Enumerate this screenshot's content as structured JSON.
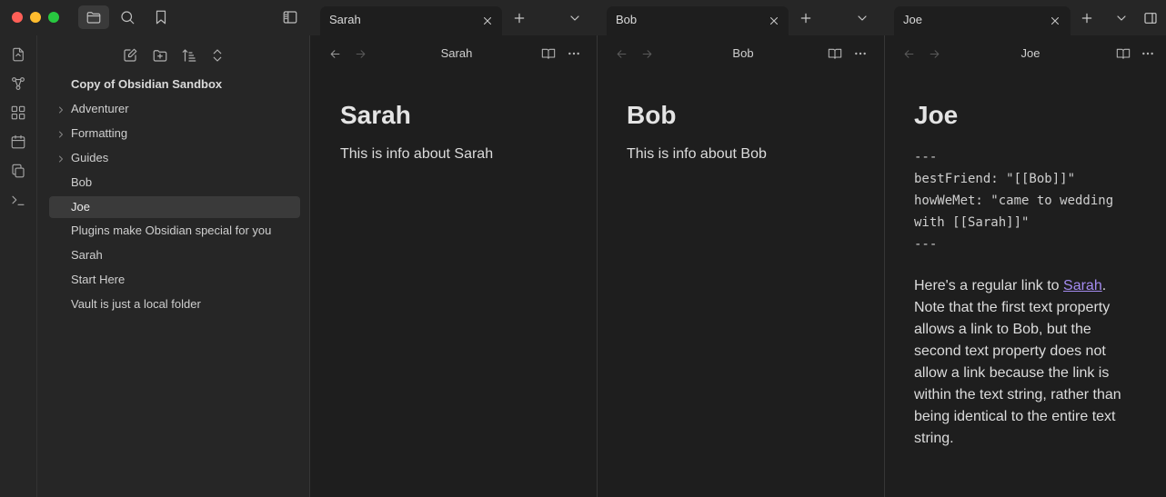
{
  "titlebar": {
    "buttons": [
      "files-icon",
      "search-icon",
      "bookmark-icon",
      "sidebar-toggle-icon"
    ],
    "tab_groups": [
      {
        "tab_label": "Sarah"
      },
      {
        "tab_label": "Bob"
      },
      {
        "tab_label": "Joe"
      }
    ]
  },
  "ribbon": {
    "icons": [
      "open-quick-switcher-icon",
      "graph-view-icon",
      "canvas-icon",
      "daily-note-icon",
      "templates-icon",
      "command-palette-icon"
    ]
  },
  "sidebar": {
    "toolbar": [
      "new-note-icon",
      "new-folder-icon",
      "sort-icon",
      "collapse-all-icon"
    ],
    "vault_name": "Copy of Obsidian Sandbox",
    "items": [
      {
        "label": "Adventurer",
        "folder": true,
        "active": false
      },
      {
        "label": "Formatting",
        "folder": true,
        "active": false
      },
      {
        "label": "Guides",
        "folder": true,
        "active": false
      },
      {
        "label": "Bob",
        "folder": false,
        "active": false
      },
      {
        "label": "Joe",
        "folder": false,
        "active": true
      },
      {
        "label": "Plugins make Obsidian special for you",
        "folder": false,
        "active": false
      },
      {
        "label": "Sarah",
        "folder": false,
        "active": false
      },
      {
        "label": "Start Here",
        "folder": false,
        "active": false
      },
      {
        "label": "Vault is just a local folder",
        "folder": false,
        "active": false
      }
    ]
  },
  "panes": {
    "sarah": {
      "view_title": "Sarah",
      "heading": "Sarah",
      "paragraph": "This is info about Sarah"
    },
    "bob": {
      "view_title": "Bob",
      "heading": "Bob",
      "paragraph": "This is info about Bob"
    },
    "joe": {
      "view_title": "Joe",
      "heading": "Joe",
      "frontmatter": "---\nbestFriend: \"[[Bob]]\"\nhowWeMet: \"came to wedding\nwith [[Sarah]]\"\n---",
      "body_before_link": "Here's a regular link to ",
      "link_text": "Sarah",
      "body_after_link": ". Note that the first text property allows a link to Bob, but the second text property does not allow a link because the link is within the text string, rather than being identical to the entire text string."
    }
  },
  "colors": {
    "link": "#a48bf0",
    "background": "#1e1e1e",
    "sidebar": "#262626"
  }
}
